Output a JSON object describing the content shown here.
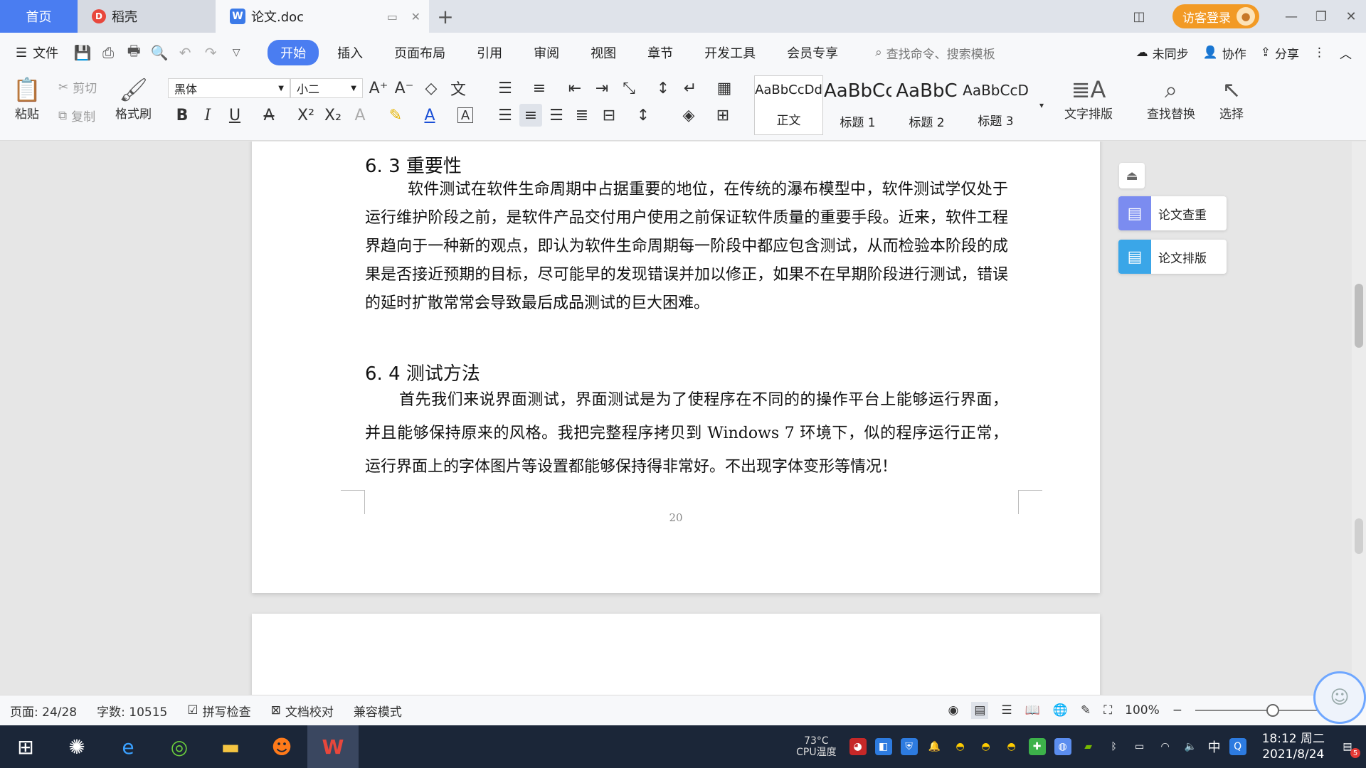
{
  "tabs": {
    "home": "首页",
    "daoke": "稻壳",
    "doc": "论文.doc",
    "visitor_login": "访客登录"
  },
  "menu": {
    "file": "文件",
    "tabs": [
      "开始",
      "插入",
      "页面布局",
      "引用",
      "审阅",
      "视图",
      "章节",
      "开发工具",
      "会员专享"
    ],
    "active_tab": "开始",
    "search_placeholder": "查找命令、搜索模板",
    "unsynced": "未同步",
    "collab": "协作",
    "share": "分享"
  },
  "ribbon": {
    "paste": "粘贴",
    "cut": "剪切",
    "copy": "复制",
    "format_painter": "格式刷",
    "font_name": "黑体",
    "font_size": "小二",
    "styles": [
      {
        "sample": "AaBbCcDd",
        "label": "正文"
      },
      {
        "sample": "AaBbCc",
        "label": "标题 1"
      },
      {
        "sample": "AaBbC",
        "label": "标题 2"
      },
      {
        "sample": "AaBbCcD",
        "label": "标题 3"
      }
    ],
    "text_layout": "文字排版",
    "find_replace": "查找替换",
    "select": "选择"
  },
  "document": {
    "heading_63": "6. 3 重要性",
    "para_63": "软件测试在软件生命周期中占据重要的地位，在传统的瀑布模型中，软件测试学仅处于运行维护阶段之前，是软件产品交付用户使用之前保证软件质量的重要手段。近来，软件工程界趋向于一种新的观点，即认为软件生命周期每一阶段中都应包含测试，从而检验本阶段的成果是否接近预期的目标，尽可能早的发现错误并加以修正，如果不在早期阶段进行测试，错误的延时扩散常常会导致最后成品测试的巨大困难。",
    "heading_64": "6. 4 测试方法",
    "para_64": "首先我们来说界面测试，界面测试是为了使程序在不同的的操作平台上能够运行界面，并且能够保持原来的风格。我把完整程序拷贝到 Windows 7 环境下，似的程序运行正常，运行界面上的字体图片等设置都能够保持得非常好。不出现字体变形等情况！",
    "page_number": "20"
  },
  "side_panel": {
    "check": "论文查重",
    "format": "论文排版"
  },
  "status": {
    "page": "页面: 24/28",
    "words": "字数: 10515",
    "spell_check": "拼写检查",
    "proofread": "文档校对",
    "compat_mode": "兼容模式",
    "zoom": "100%"
  },
  "taskbar": {
    "cpu_temp": "73°C",
    "cpu_label": "CPU温度",
    "ime": "中",
    "time": "18:12 周二",
    "date": "2021/8/24",
    "notification_count": "5"
  },
  "colors": {
    "accent": "#4a7df1",
    "visitor": "#f29a25",
    "taskbar": "#1b2638"
  }
}
